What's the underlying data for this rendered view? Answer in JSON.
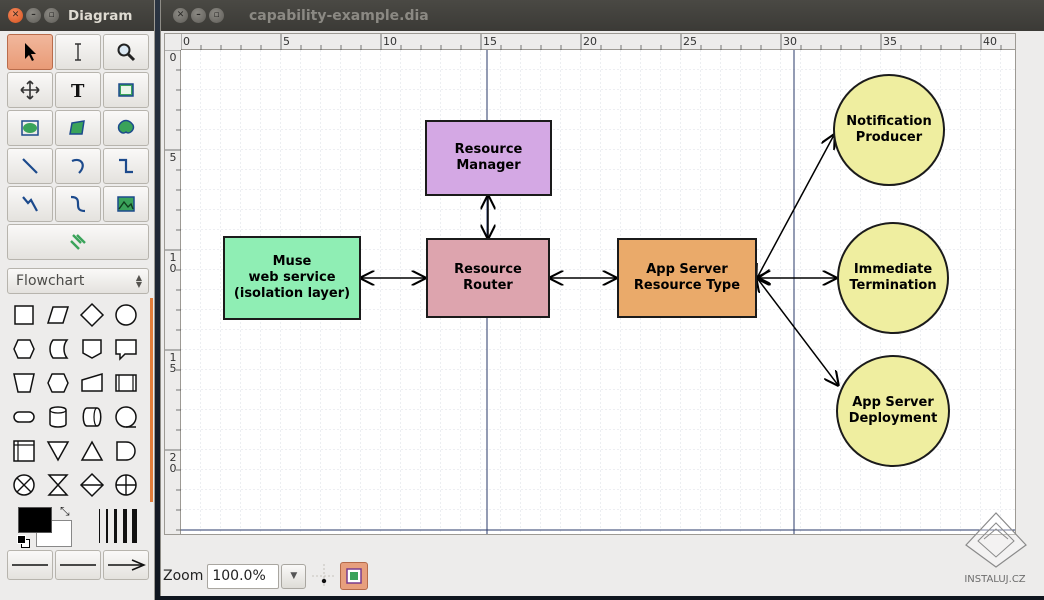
{
  "toolbox": {
    "title": "Diagram",
    "sheet_selector": {
      "selected": "Flowchart"
    }
  },
  "diagram_window": {
    "title": "capability-example.dia",
    "ruler": {
      "h_labels": [
        "0",
        "5",
        "10",
        "15",
        "20",
        "25",
        "30",
        "35",
        "40"
      ],
      "v_labels": [
        "0",
        "5",
        "1\n0",
        "1\n5",
        "2\n0"
      ]
    },
    "nodes": {
      "resource_manager": {
        "label_l1": "Resource",
        "label_l2": "Manager",
        "color": "#d4a8e4"
      },
      "muse": {
        "label_l1": "Muse",
        "label_l2": "web service",
        "label_l3": "(isolation layer)",
        "color": "#8feeb4"
      },
      "resource_router": {
        "label_l1": "Resource",
        "label_l2": "Router",
        "color": "#dda4ae"
      },
      "app_server_type": {
        "label_l1": "App Server",
        "label_l2": "Resource Type",
        "color": "#eaaa6a"
      },
      "notification_producer": {
        "label_l1": "Notification",
        "label_l2": "Producer",
        "color": "#efeea0"
      },
      "immediate_termination": {
        "label_l1": "Immediate",
        "label_l2": "Termination",
        "color": "#efeea0"
      },
      "app_server_deployment": {
        "label_l1": "App Server",
        "label_l2": "Deployment",
        "color": "#efeea0"
      }
    },
    "statusbar": {
      "zoom_label": "Zoom",
      "zoom_value": "100.0%"
    }
  },
  "watermark": {
    "text": "INSTALUJ.CZ"
  }
}
